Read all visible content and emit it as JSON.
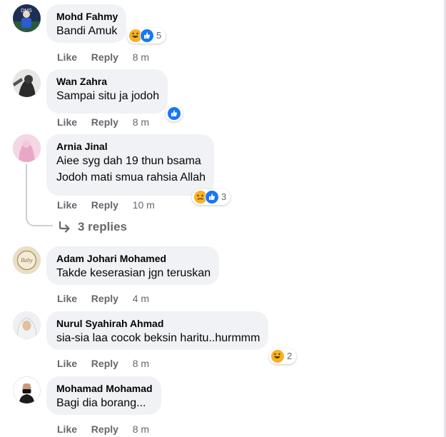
{
  "comments": [
    {
      "author": "Mohd Fahmy",
      "lines": [
        "Bandi Amuk"
      ],
      "like_label": "Like",
      "reply_label": "Reply",
      "time": "8 m",
      "reactions": [
        "laugh-icon",
        "like-icon"
      ],
      "reaction_count": "5"
    },
    {
      "author": "Wan Zahra",
      "lines": [
        "Sampai situ ja jodoh"
      ],
      "like_label": "Like",
      "reply_label": "Reply",
      "time": "8 m",
      "reactions": [
        "like-icon"
      ],
      "reaction_count": ""
    },
    {
      "author": "Arnia Jinal",
      "lines": [
        "Aiee syg dah 19 thun bsama",
        "Jodoh mati smua rahsia Allah"
      ],
      "like_label": "Like",
      "reply_label": "Reply",
      "time": "10 m",
      "reactions": [
        "sad-icon",
        "like-icon"
      ],
      "reaction_count": "3",
      "replies_label": "3 replies"
    },
    {
      "author": "Adam Johari Mohamed",
      "lines": [
        "Takde keserasian jgn teruskan"
      ],
      "like_label": "Like",
      "reply_label": "Reply",
      "time": "4 m",
      "reactions": [],
      "reaction_count": ""
    },
    {
      "author": "Nurul Syahirah Ahmad",
      "lines": [
        "sia-sia laa cocok beksin haritu..hurmmm"
      ],
      "like_label": "Like",
      "reply_label": "Reply",
      "time": "8 m",
      "reactions": [
        "laugh-icon"
      ],
      "reaction_count": "2"
    },
    {
      "author": "Mohamad Mohamad",
      "lines": [
        "Bagi dia borang..."
      ],
      "like_label": "Like",
      "reply_label": "Reply",
      "time": "8 m",
      "reactions": [],
      "reaction_count": ""
    }
  ],
  "avatar_badge_text": "Baby",
  "colors": {
    "bubble": "#f0f2f5",
    "secondary_text": "#65676b",
    "like_blue": "#1877f2",
    "emoji_yellow": "#f7b125"
  }
}
